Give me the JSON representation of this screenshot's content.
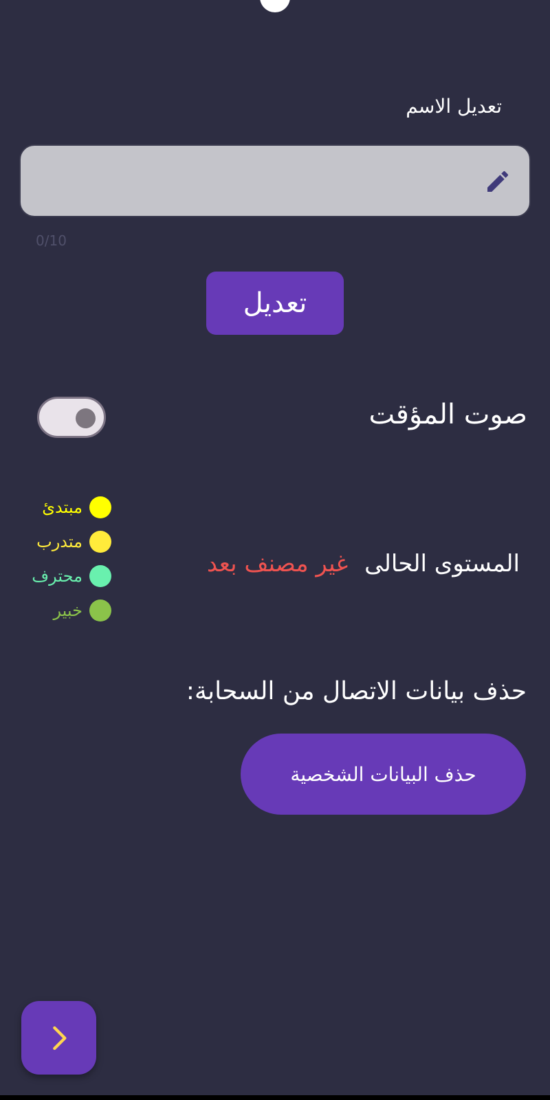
{
  "name_field": {
    "label": "تعديل الاسم",
    "value": "",
    "placeholder": "",
    "counter": "0/10"
  },
  "edit_button": {
    "label": "تعديل"
  },
  "timer_sound": {
    "label": "صوت المؤقت",
    "enabled": false
  },
  "level": {
    "label": "المستوى الحالى",
    "value": "غير مصنف بعد",
    "value_color": "#ef5350"
  },
  "legend": [
    {
      "label": "مبتدئ",
      "color": "#ffff00"
    },
    {
      "label": "متدرب",
      "color": "#ffeb3b"
    },
    {
      "label": "محترف",
      "color": "#69f0ae"
    },
    {
      "label": "خبير",
      "color": "#8bc34a"
    }
  ],
  "cloud": {
    "label": "حذف بيانات الاتصال من السحابة:",
    "delete_button_label": "حذف البيانات الشخصية"
  },
  "colors": {
    "background": "#2d2d42",
    "accent": "#673ab7",
    "fab_icon": "#ffd54f",
    "input_bg": "#c4c4ca",
    "pencil": "#3f3a7a"
  },
  "icons": {
    "edit": "pencil-icon",
    "next": "chevron-right-icon"
  }
}
